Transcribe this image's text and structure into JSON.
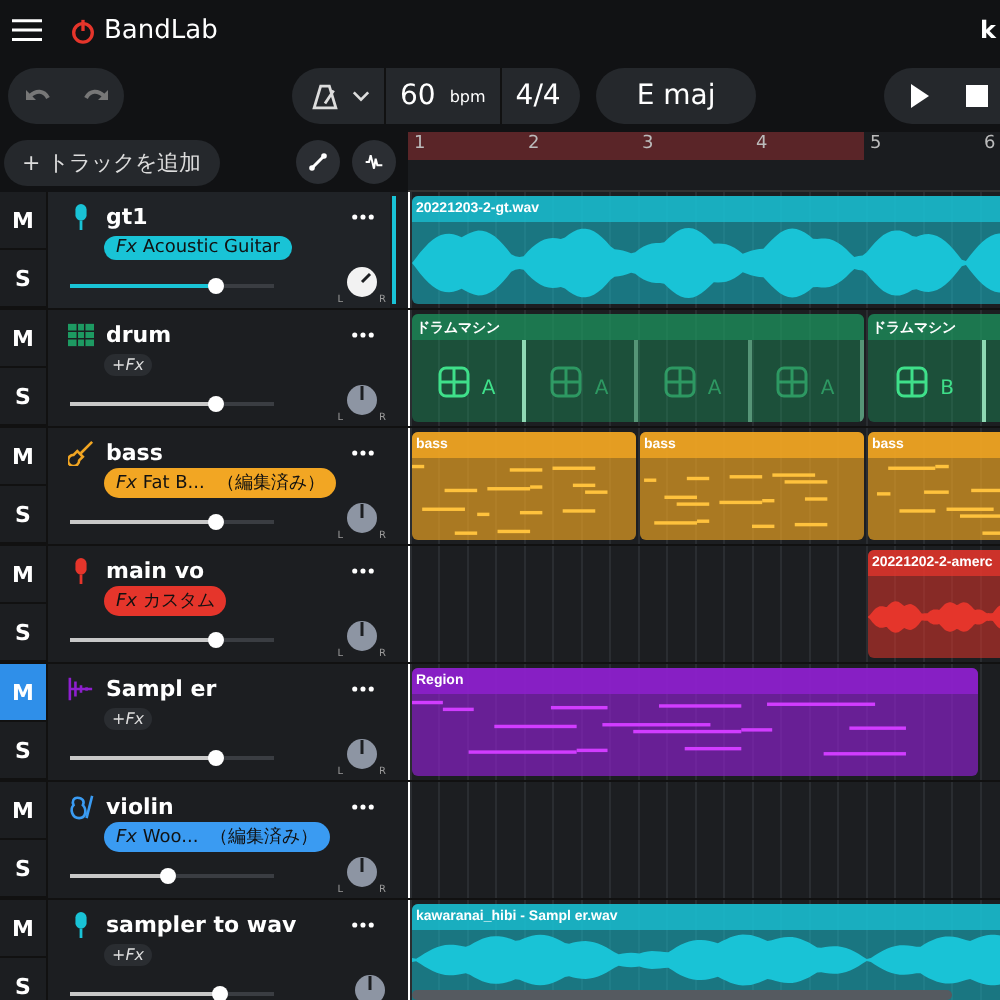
{
  "header": {
    "logo": "BandLab",
    "user_initial": "k"
  },
  "toolbar": {
    "tempo": "60",
    "tempo_unit": "bpm",
    "time_signature": "4/4",
    "key": "E maj"
  },
  "add_track": "+ トラックを追加",
  "ruler": {
    "bars": [
      "1",
      "2",
      "3",
      "4",
      "5",
      "6"
    ]
  },
  "tracks": [
    {
      "name": "gt1",
      "kind": "mic",
      "color": "#19c3d6",
      "selected": true,
      "mute": "M",
      "solo": "S",
      "muted": false,
      "soloed": false,
      "level": 0.72,
      "pan_left": "L",
      "pan_right": "R",
      "fx": {
        "kind": "effect",
        "prefix": "Fx",
        "name": "Acoustic Guitar"
      },
      "regions": [
        {
          "kind": "audio",
          "name": "20221203-2-gt.wav"
        }
      ]
    },
    {
      "name": "drum",
      "kind": "grid",
      "color": "#1d9a62",
      "selected": false,
      "mute": "M",
      "solo": "S",
      "muted": false,
      "soloed": false,
      "level": 0.72,
      "pan_left": "L",
      "pan_right": "R",
      "fx": {
        "kind": "add",
        "prefix": "+Fx"
      },
      "regions": [
        {
          "kind": "drum",
          "name": "ドラムマシン",
          "cells": [
            "A",
            "A",
            "A",
            "A"
          ]
        },
        {
          "kind": "drum",
          "name": "ドラムマシン",
          "cells": [
            "B"
          ]
        }
      ]
    },
    {
      "name": "bass",
      "kind": "guitar",
      "color": "#f2a623",
      "selected": false,
      "mute": "M",
      "solo": "S",
      "muted": false,
      "soloed": false,
      "level": 0.72,
      "pan_left": "L",
      "pan_right": "R",
      "fx": {
        "kind": "effect",
        "prefix": "Fx",
        "name": "Fat B...",
        "note": "（編集済み）"
      },
      "regions": [
        {
          "kind": "midi",
          "name": "bass"
        },
        {
          "kind": "midi",
          "name": "bass"
        },
        {
          "kind": "midi",
          "name": "bass"
        }
      ]
    },
    {
      "name": "main vo",
      "kind": "mic",
      "color": "#e5352b",
      "selected": false,
      "mute": "M",
      "solo": "S",
      "muted": false,
      "soloed": false,
      "level": 0.72,
      "pan_left": "L",
      "pan_right": "R",
      "fx": {
        "kind": "effect",
        "prefix": "Fx",
        "name": "カスタム"
      },
      "regions": [
        {
          "kind": "audio",
          "name": "20221202-2-amerc"
        }
      ]
    },
    {
      "name": "Sampl er",
      "kind": "sampler",
      "color": "#8e1fcf",
      "selected": false,
      "mute": "M",
      "solo": "S",
      "muted": true,
      "soloed": false,
      "level": 0.72,
      "pan_left": "L",
      "pan_right": "R",
      "fx": {
        "kind": "add",
        "prefix": "+Fx"
      },
      "regions": [
        {
          "kind": "midi",
          "name": "Region"
        }
      ]
    },
    {
      "name": "violin",
      "kind": "violin",
      "color": "#3a9bf2",
      "selected": false,
      "mute": "M",
      "solo": "S",
      "muted": false,
      "soloed": false,
      "level": 0.48,
      "pan_left": "L",
      "pan_right": "R",
      "fx": {
        "kind": "effect",
        "prefix": "Fx",
        "name": "Woo...",
        "note": "（編集済み）"
      }
    },
    {
      "name": "sampler to wav",
      "kind": "mic",
      "color": "#19c3d6",
      "selected": false,
      "mute": "M",
      "solo": "S",
      "muted": false,
      "soloed": false,
      "level": 0.74,
      "fx": {
        "kind": "add",
        "prefix": "+Fx"
      },
      "regions": [
        {
          "kind": "audio",
          "name": "kawaranai_hibi - Sampl er.wav"
        }
      ]
    }
  ]
}
